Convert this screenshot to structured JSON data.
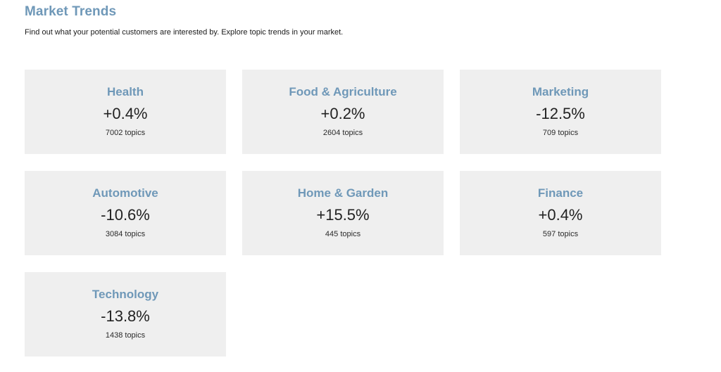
{
  "header": {
    "title": "Market Trends",
    "subtitle": "Find out what your potential customers are interested by. Explore topic trends in your market."
  },
  "colors": {
    "accent": "#6f98b8",
    "card_background": "#efefef",
    "value_text": "#222222"
  },
  "categories": [
    {
      "name": "Health",
      "change": "+0.4%",
      "topics": "7002 topics"
    },
    {
      "name": "Food & Agriculture",
      "change": "+0.2%",
      "topics": "2604 topics"
    },
    {
      "name": "Marketing",
      "change": "-12.5%",
      "topics": "709 topics"
    },
    {
      "name": "Automotive",
      "change": "-10.6%",
      "topics": "3084 topics"
    },
    {
      "name": "Home & Garden",
      "change": "+15.5%",
      "topics": "445 topics"
    },
    {
      "name": "Finance",
      "change": "+0.4%",
      "topics": "597 topics"
    },
    {
      "name": "Technology",
      "change": "-13.8%",
      "topics": "1438 topics"
    }
  ]
}
